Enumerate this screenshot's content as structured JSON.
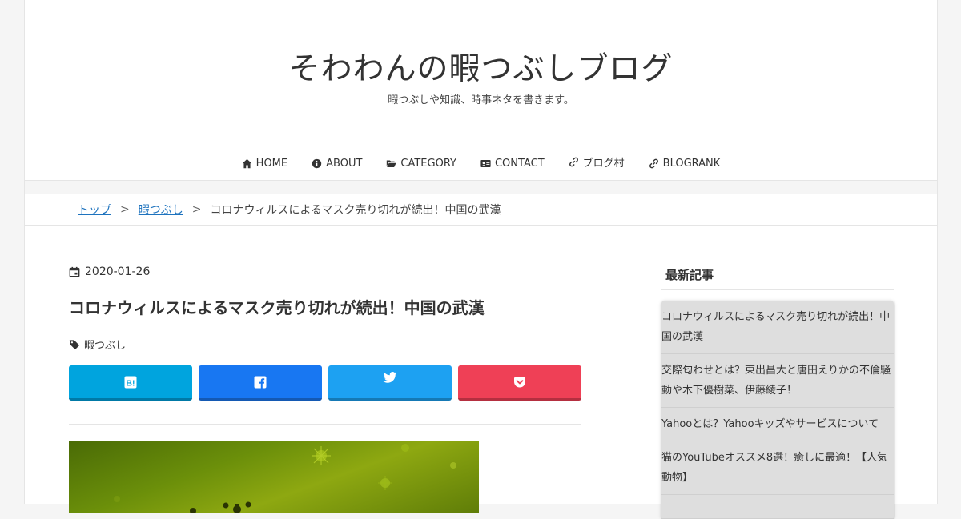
{
  "site": {
    "title": "そわわんの暇つぶしブログ",
    "description": "暇つぶしや知識、時事ネタを書きます。"
  },
  "nav": [
    {
      "label": "HOME",
      "icon": "home-icon"
    },
    {
      "label": "ABOUT",
      "icon": "info-icon"
    },
    {
      "label": "CATEGORY",
      "icon": "folder-open-icon"
    },
    {
      "label": "CONTACT",
      "icon": "address-card-icon"
    },
    {
      "label": "ブログ村",
      "icon": "link-icon"
    },
    {
      "label": "BLOGRANK",
      "icon": "link-icon"
    }
  ],
  "breadcrumb": {
    "home": "トップ",
    "separator": ">",
    "category": "暇つぶし",
    "current": "コロナウィルスによるマスク売り切れが続出！中国の武漢"
  },
  "post": {
    "date": "2020-01-26",
    "title": "コロナウィルスによるマスク売り切れが続出！中国の武漢",
    "tag": "暇つぶし"
  },
  "share": [
    {
      "service": "hatena",
      "icon": "hatena-bookmark-icon",
      "color": "#00a4de"
    },
    {
      "service": "facebook",
      "icon": "facebook-icon",
      "color": "#1877f2"
    },
    {
      "service": "twitter",
      "icon": "twitter-icon",
      "color": "#1da1f2"
    },
    {
      "service": "pocket",
      "icon": "pocket-icon",
      "color": "#ef4056"
    }
  ],
  "sidebar": {
    "widget_title": "最新記事",
    "recent_posts": [
      "コロナウィルスによるマスク売り切れが続出！中国の武漢",
      "交際匂わせとは？東出昌大と唐田えりかの不倫騒動や木下優樹菜、伊藤綾子！",
      "Yahooとは？Yahooキッズやサービスについて",
      "猫のYouTubeオススメ8選！癒しに最適！【人気動物】"
    ]
  },
  "colors": {
    "link": "#1e73be",
    "text": "#333333",
    "background": "#f5f5f5"
  }
}
